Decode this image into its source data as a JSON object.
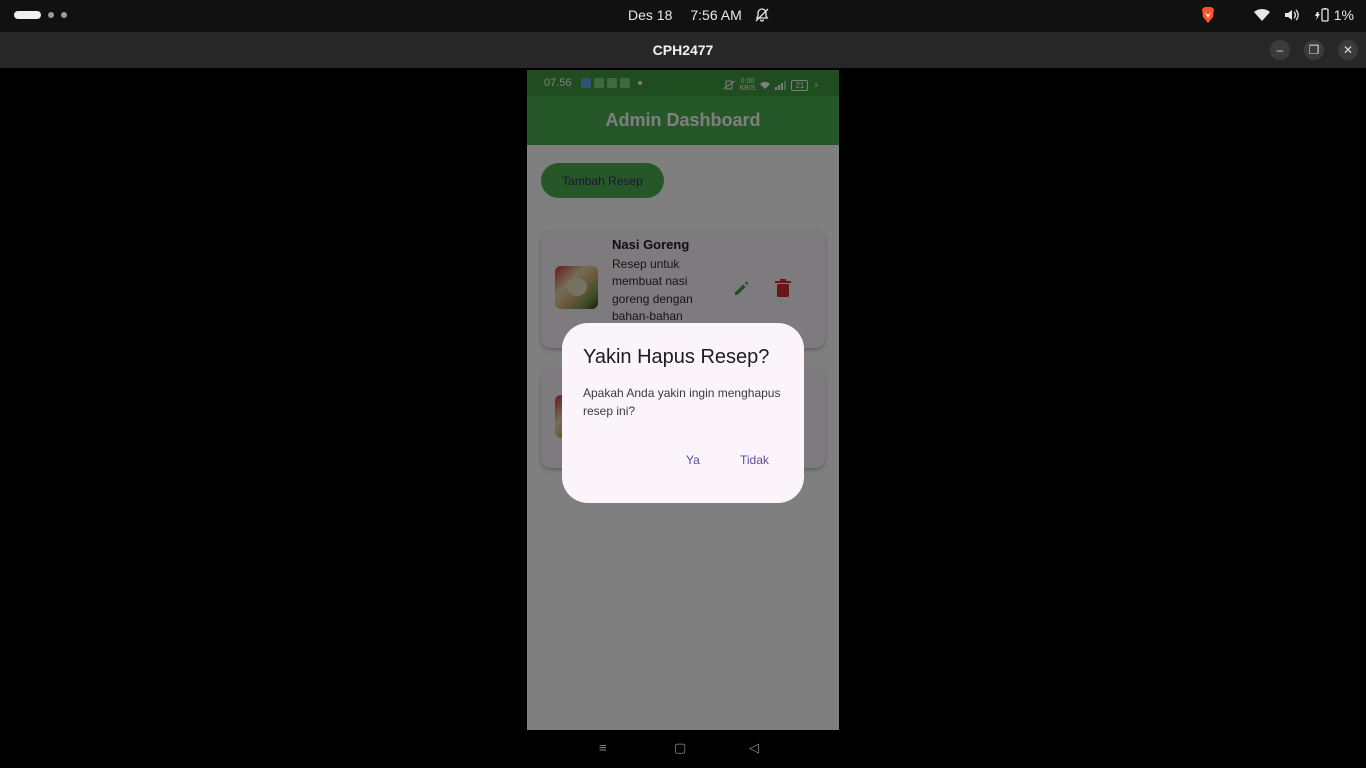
{
  "topbar": {
    "date": "Des 18",
    "time": "7:56 AM",
    "battery_percent": "1%"
  },
  "window": {
    "title": "CPH2477"
  },
  "phone": {
    "status_time": "07.56",
    "battery_level": "21",
    "net_speed_top": "0.00",
    "net_speed_bottom": "KB/S",
    "app_title": "Admin Dashboard",
    "add_button_label": "Tambah Resep",
    "recipes": [
      {
        "title": "Nasi Goreng",
        "description": "Resep untuk membuat nasi goreng dengan bahan-bahan"
      }
    ]
  },
  "dialog": {
    "title": "Yakin Hapus Resep?",
    "body": "Apakah Anda yakin ingin menghapus resep ini?",
    "confirm_label": "Ya",
    "cancel_label": "Tidak"
  },
  "nav": {
    "menu_icon": "≡",
    "home_icon": "▢",
    "back_icon": "◁"
  },
  "colors": {
    "app_green": "#4caf50",
    "delete_red": "#d32f2f",
    "edit_green": "#43a047",
    "dialog_bg": "#fcf4fb",
    "dialog_button": "#5b4a9a"
  }
}
